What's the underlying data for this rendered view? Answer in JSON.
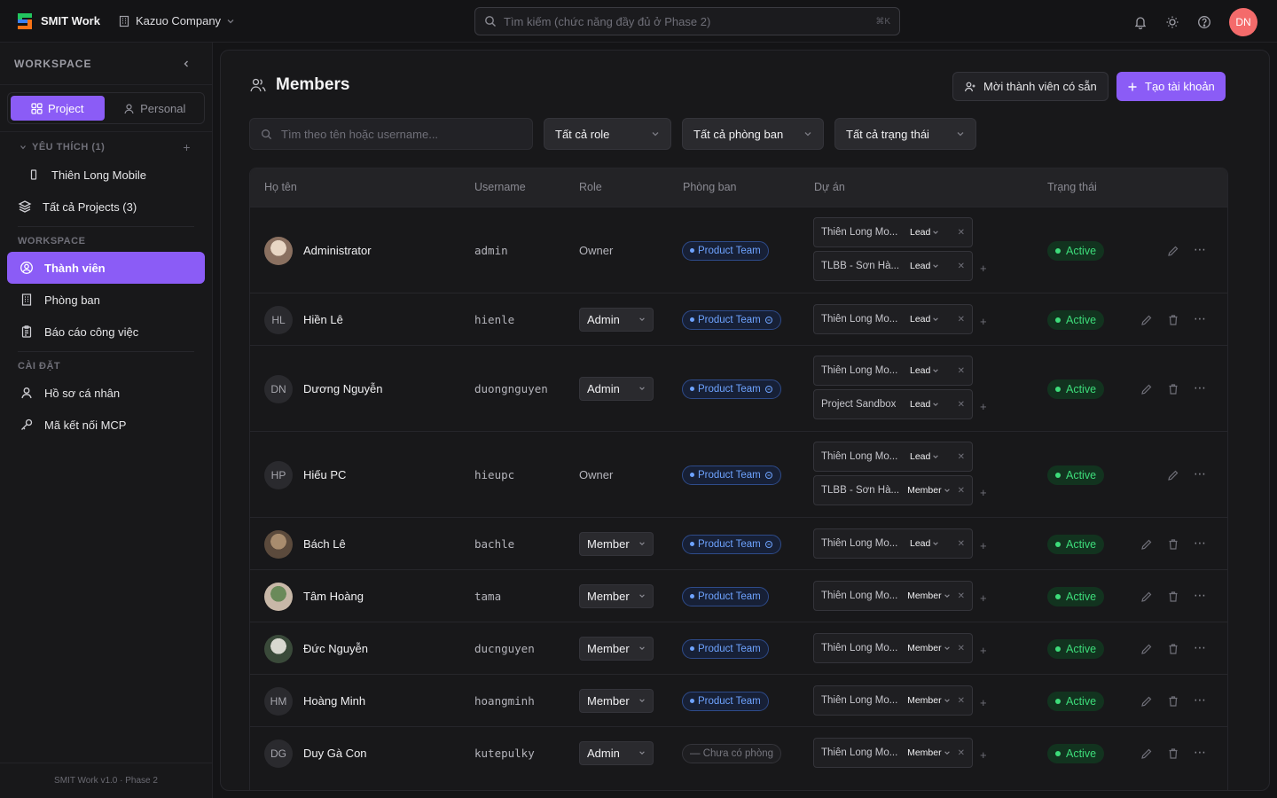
{
  "app": {
    "name": "SMIT Work",
    "company": "Kazuo Company"
  },
  "topbar": {
    "search_placeholder": "Tìm kiếm (chức năng đầy đủ ở Phase 2)",
    "search_kbd": "⌘K",
    "user_initials": "DN"
  },
  "sidebar": {
    "title": "WORKSPACE",
    "tabs": [
      {
        "label": "Project"
      },
      {
        "label": "Personal"
      }
    ],
    "favorites_label": "YÊU THÍCH (1)",
    "favorites": [
      {
        "label": "Thiên Long Mobile"
      }
    ],
    "all_projects": "Tất cả Projects (3)",
    "workspace_label": "WORKSPACE",
    "workspace_items": [
      {
        "label": "Thành viên"
      },
      {
        "label": "Phòng ban"
      },
      {
        "label": "Báo cáo công việc"
      }
    ],
    "settings_label": "CÀI ĐẶT",
    "settings_items": [
      {
        "label": "Hồ sơ cá nhân"
      },
      {
        "label": "Mã kết nối MCP"
      }
    ],
    "footer": "SMIT Work v1.0 · Phase 2"
  },
  "page": {
    "title": "Members",
    "invite_button": "Mời thành viên có sẵn",
    "create_button": "Tạo tài khoản",
    "search_placeholder": "Tìm theo tên hoặc username...",
    "filters": [
      "Tất cả role",
      "Tất cả phòng ban",
      "Tất cả trạng thái"
    ]
  },
  "table": {
    "headers": [
      "Họ tên",
      "Username",
      "Role",
      "Phòng ban",
      "Dự án",
      "Trạng thái"
    ],
    "rows": [
      {
        "initials": "",
        "photo": true,
        "name": "Administrator",
        "username": "admin",
        "role": "Owner",
        "role_editable": false,
        "dept": "Product Team",
        "dept_icon": false,
        "projects": [
          {
            "name": "Thiên Long Mo...",
            "role": "Lead"
          },
          {
            "name": "TLBB - Sơn Hà...",
            "role": "Lead"
          }
        ],
        "status": "Active",
        "can_delete": false
      },
      {
        "initials": "HL",
        "photo": false,
        "name": "Hiền Lê",
        "username": "hienle",
        "role": "Admin",
        "role_editable": true,
        "dept": "Product Team",
        "dept_icon": true,
        "projects": [
          {
            "name": "Thiên Long Mo...",
            "role": "Lead"
          }
        ],
        "status": "Active",
        "can_delete": true
      },
      {
        "initials": "DN",
        "photo": false,
        "name": "Dương Nguyễn",
        "username": "duongnguyen",
        "role": "Admin",
        "role_editable": true,
        "dept": "Product Team",
        "dept_icon": true,
        "projects": [
          {
            "name": "Thiên Long Mo...",
            "role": "Lead"
          },
          {
            "name": "Project Sandbox",
            "role": "Lead"
          }
        ],
        "status": "Active",
        "can_delete": true
      },
      {
        "initials": "HP",
        "photo": false,
        "name": "Hiếu PC",
        "username": "hieupc",
        "role": "Owner",
        "role_editable": false,
        "dept": "Product Team",
        "dept_icon": true,
        "projects": [
          {
            "name": "Thiên Long Mo...",
            "role": "Lead"
          },
          {
            "name": "TLBB - Sơn Hà...",
            "role": "Member"
          }
        ],
        "status": "Active",
        "can_delete": false
      },
      {
        "initials": "",
        "photo": true,
        "name": "Bách Lê",
        "username": "bachle",
        "role": "Member",
        "role_editable": true,
        "dept": "Product Team",
        "dept_icon": true,
        "projects": [
          {
            "name": "Thiên Long Mo...",
            "role": "Lead"
          }
        ],
        "status": "Active",
        "can_delete": true
      },
      {
        "initials": "",
        "photo": true,
        "name": "Tâm Hoàng",
        "username": "tama",
        "role": "Member",
        "role_editable": true,
        "dept": "Product Team",
        "dept_icon": false,
        "projects": [
          {
            "name": "Thiên Long Mo...",
            "role": "Member"
          }
        ],
        "status": "Active",
        "can_delete": true
      },
      {
        "initials": "",
        "photo": true,
        "name": "Đức Nguyễn",
        "username": "ducnguyen",
        "role": "Member",
        "role_editable": true,
        "dept": "Product Team",
        "dept_icon": false,
        "projects": [
          {
            "name": "Thiên Long Mo...",
            "role": "Member"
          }
        ],
        "status": "Active",
        "can_delete": true
      },
      {
        "initials": "HM",
        "photo": false,
        "name": "Hoàng Minh",
        "username": "hoangminh",
        "role": "Member",
        "role_editable": true,
        "dept": "Product Team",
        "dept_icon": false,
        "projects": [
          {
            "name": "Thiên Long Mo...",
            "role": "Member"
          }
        ],
        "status": "Active",
        "can_delete": true
      },
      {
        "initials": "DG",
        "photo": false,
        "name": "Duy Gà Con",
        "username": "kutepulky",
        "role": "Admin",
        "role_editable": true,
        "dept": "— Chưa có phòng",
        "dept_icon": false,
        "dept_none": true,
        "projects": [
          {
            "name": "Thiên Long Mo...",
            "role": "Member"
          }
        ],
        "status": "Active",
        "can_delete": true
      }
    ]
  },
  "colors": {
    "accent": "#8b5cf6",
    "status_active": "#3ddc7a",
    "dept_blue": "#6ea3ff",
    "avatar_user": "#f46b6b"
  }
}
